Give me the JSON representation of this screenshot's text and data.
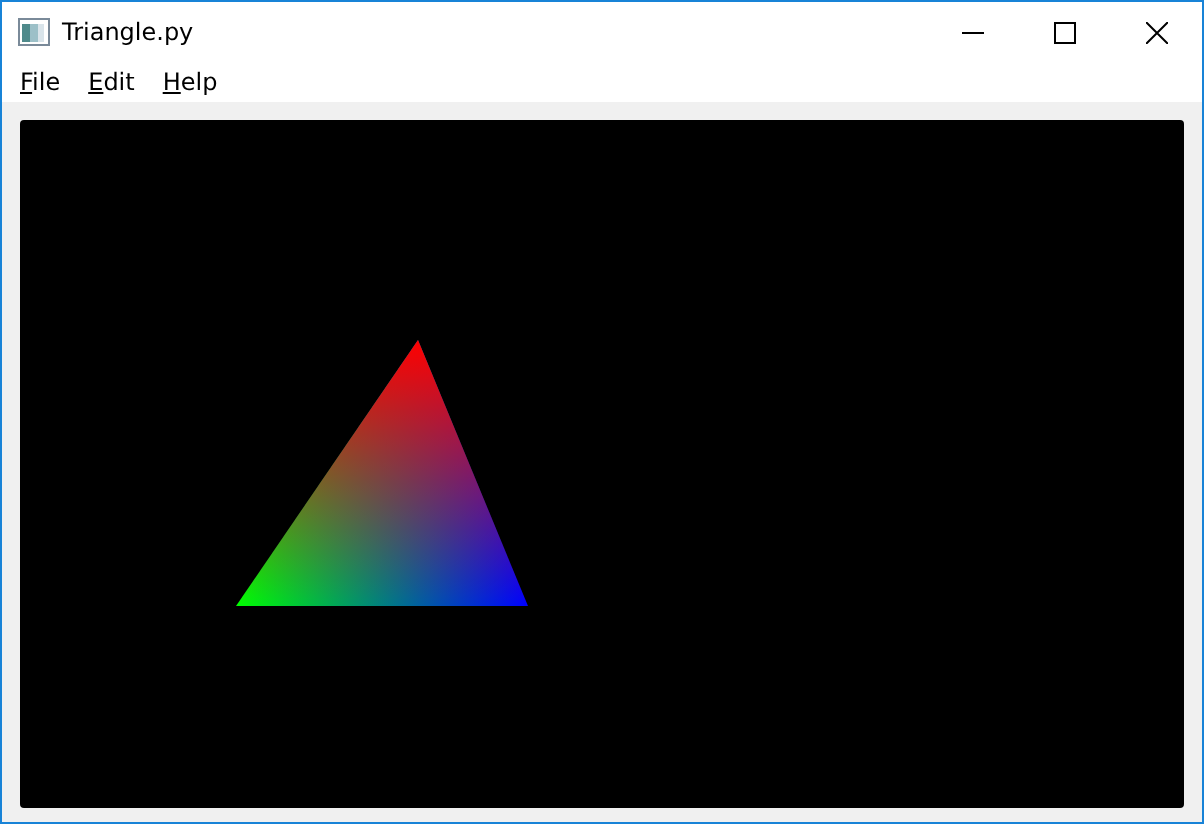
{
  "window": {
    "title": "Triangle.py"
  },
  "menu": [
    {
      "label": "File"
    },
    {
      "label": "Edit"
    },
    {
      "label": "Help"
    }
  ]
}
